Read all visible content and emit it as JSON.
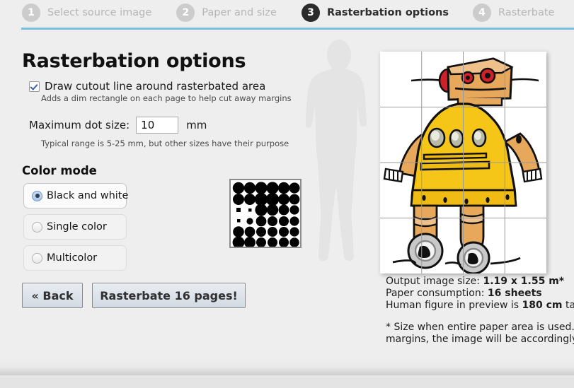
{
  "steps": [
    {
      "number": "1",
      "label": "Select source image",
      "active": false
    },
    {
      "number": "2",
      "label": "Paper and size",
      "active": false
    },
    {
      "number": "3",
      "label": "Rasterbation options",
      "active": true
    },
    {
      "number": "4",
      "label": "Rasterbate",
      "active": false
    }
  ],
  "page": {
    "title": "Rasterbation options"
  },
  "cutout": {
    "label": "Draw cutout line around rasterbated area",
    "hint": "Adds a dim rectangle on each page to help cut away margins",
    "checked": true
  },
  "dot_size": {
    "label": "Maximum dot size:",
    "value": "10",
    "unit": "mm",
    "hint": "Typical range is 5-25 mm, but other sizes have their purpose"
  },
  "color_mode": {
    "title": "Color mode",
    "selected": "Black and white",
    "options": [
      {
        "label": "Black and white",
        "selected": true
      },
      {
        "label": "Single color",
        "selected": false
      },
      {
        "label": "Multicolor",
        "selected": false
      }
    ]
  },
  "buttons": {
    "back": "« Back",
    "rasterbate": "Rasterbate 16 pages!"
  },
  "info": {
    "output_size_label": "Output image size:",
    "output_size_value": "1.19 x 1.55 m*",
    "paper_label": "Paper consumption:",
    "paper_value": "16 sheets",
    "human_label_pre": "Human figure in preview is",
    "human_value": "180 cm",
    "human_label_post": "tall",
    "note_line1": "* Size when entire paper area is used. If you choose to leave",
    "note_line2": "margins, the image will be accordingly smaller."
  },
  "preview": {
    "grid_cols": 4,
    "grid_rows": 4,
    "sheets": 16,
    "paper_color": "#ffffff",
    "grid_line_color": "#9a9a9a",
    "human_silhouette_color": "#e4e4e4",
    "robot_body_color": "#f5c518",
    "robot_head_color": "#e8a85c",
    "robot_eye_color": "#d0202a",
    "robot_outline_color": "#111111"
  },
  "theme": {
    "background": "#eeeeee",
    "accent_rule": "#79bedd",
    "active_step_bg": "#2b2b2b",
    "inactive_step_bg": "#cccccc"
  }
}
